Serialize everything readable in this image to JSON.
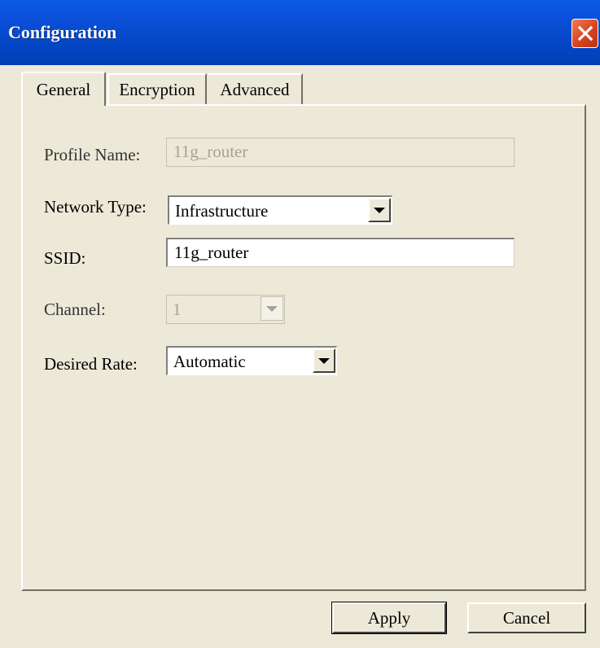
{
  "window": {
    "title": "Configuration",
    "accent": "#0a4fd8",
    "close_color": "#d8431f"
  },
  "tabs": [
    {
      "label": "General",
      "active": true
    },
    {
      "label": "Encryption",
      "active": false
    },
    {
      "label": "Advanced",
      "active": false
    }
  ],
  "form": {
    "profile_name": {
      "label": "Profile Name:",
      "value": "11g_router",
      "enabled": false
    },
    "network_type": {
      "label": "Network Type:",
      "value": "Infrastructure"
    },
    "ssid": {
      "label": "SSID:",
      "value": "11g_router"
    },
    "channel": {
      "label": "Channel:",
      "value": "1",
      "enabled": false
    },
    "desired_rate": {
      "label": "Desired Rate:",
      "value": "Automatic"
    }
  },
  "buttons": {
    "apply": "Apply",
    "cancel": "Cancel"
  },
  "icons": {
    "close": "close-icon",
    "dropdown": "chevron-down-icon"
  }
}
